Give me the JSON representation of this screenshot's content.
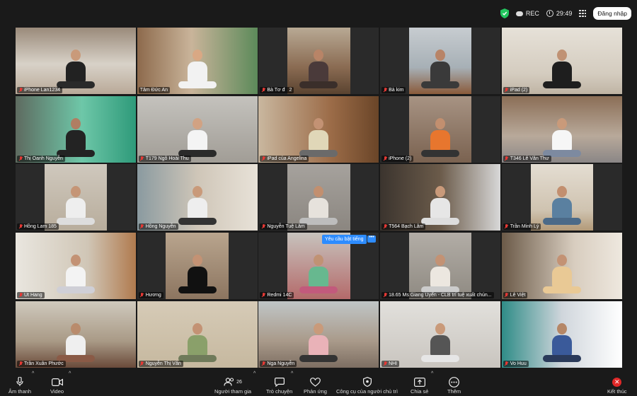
{
  "topbar": {
    "rec_label": "REC",
    "timer": "29:49",
    "signin_label": "Đăng nhập"
  },
  "participants": [
    {
      "name": "iPhone Lan1234",
      "muted": true,
      "pinned": true
    },
    {
      "name": "Tâm Đức An",
      "muted": false
    },
    {
      "name": "Bà Tơ             đ",
      "muted": true,
      "extra": "2"
    },
    {
      "name": "Bà kim",
      "muted": true
    },
    {
      "name": "iPad (2)",
      "muted": true
    },
    {
      "name": "Thị Oanh Nguyễn",
      "muted": true
    },
    {
      "name": "T179 Ngô Hoài Thu",
      "muted": true
    },
    {
      "name": "iPad của Angelina",
      "muted": true
    },
    {
      "name": "iPhone (2)",
      "muted": true
    },
    {
      "name": "T346 Lê Văn Thư",
      "muted": true
    },
    {
      "name": "Hồng Lam 185",
      "muted": true
    },
    {
      "name": "Hồng  Nguyễn",
      "muted": true
    },
    {
      "name": "Nguyễn Tuệ Lâm",
      "muted": true
    },
    {
      "name": "T564 Bạch Lâm",
      "muted": true
    },
    {
      "name": "Trần Minh Lý",
      "muted": true
    },
    {
      "name": "Ut Hang",
      "muted": true
    },
    {
      "name": "Hương",
      "muted": true
    },
    {
      "name": "Redmi 14C",
      "muted": true
    },
    {
      "name": "18.65 Ms Giang Uyển - CLB trí tuệ xuất chún...",
      "muted": true
    },
    {
      "name": "Lê Việt",
      "muted": true
    },
    {
      "name": "Trần Xuân Phước",
      "muted": true
    },
    {
      "name": "Nguyễn Thị Vân",
      "muted": true
    },
    {
      "name": "Nga Nguyễn",
      "muted": true
    },
    {
      "name": "NHI",
      "muted": true
    },
    {
      "name": "Vo Huu",
      "muted": true
    }
  ],
  "unmute_request": {
    "label": "Yêu cầu bật tiếng",
    "more": "•••"
  },
  "toolbar": {
    "audio_label": "Âm thanh",
    "video_label": "Video",
    "participants_label": "Người tham gia",
    "participants_count": "26",
    "chat_label": "Trò chuyện",
    "reactions_label": "Phản ứng",
    "host_tools_label": "Công cụ của người chủ trì",
    "share_label": "Chia sẻ",
    "more_label": "Thêm",
    "end_label": "Kết thúc"
  }
}
